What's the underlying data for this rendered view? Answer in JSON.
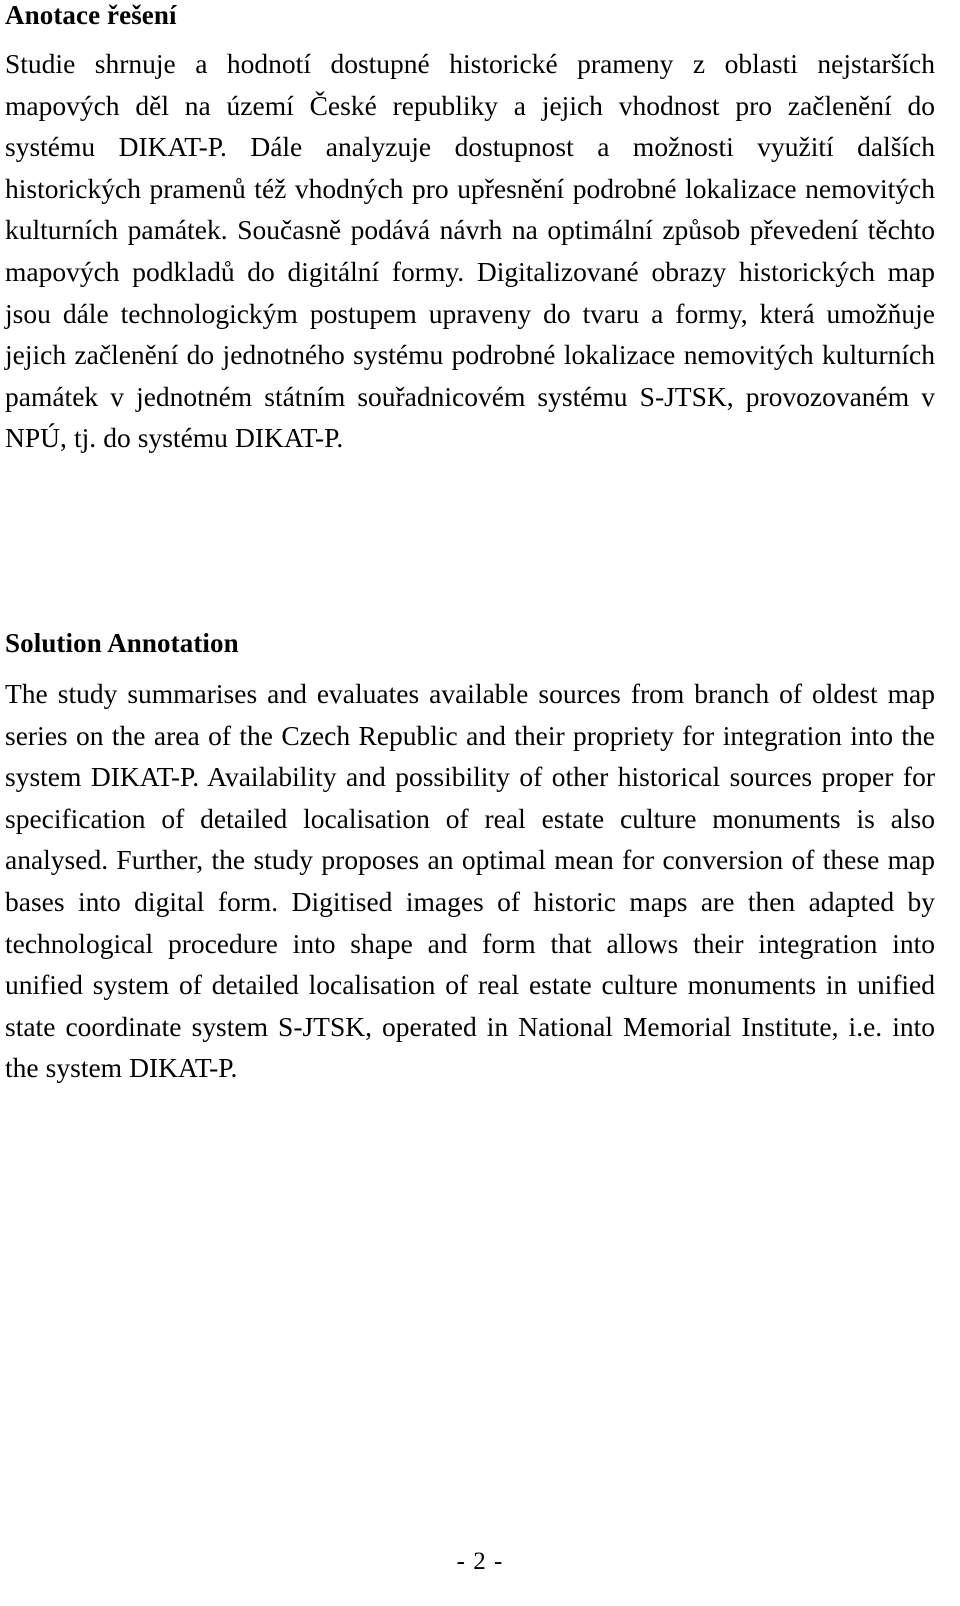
{
  "document": {
    "page_number_label": "- 2 -"
  },
  "sections": {
    "czech": {
      "heading": "Anotace řešení",
      "body": "Studie shrnuje a hodnotí dostupné historické prameny z oblasti nejstarších mapových děl na území České republiky a jejich vhodnost pro začlenění do systému DIKAT-P. Dále analyzuje dostupnost a možnosti využití dalších historických pramenů též vhodných pro upřesnění podrobné lokalizace nemovitých kulturních památek. Současně podává návrh na optimální způsob převedení těchto mapových podkladů do digitální formy. Digitalizované obrazy historických map jsou dále technologickým postupem upraveny do tvaru a formy, která umožňuje jejich začlenění do jednotného systému podrobné lokalizace nemovitých kulturních památek v jednotném státním souřadnicovém systému S-JTSK, provozovaném v NPÚ, tj. do systému DIKAT-P."
    },
    "english": {
      "heading": "Solution Annotation",
      "body": "The study summarises and evaluates available sources from branch of oldest map series on the area of the Czech Republic and their propriety for integration into the system DIKAT-P. Availability and possibility of other historical sources proper for specification of detailed localisation of real estate culture monuments is also analysed. Further, the study proposes an optimal mean for conversion of these map bases into digital form. Digitised images of historic maps are then adapted by technological procedure into shape and form that allows their integration into unified system of detailed localisation of real estate culture monuments in unified state coordinate system S-JTSK, operated in National Memorial Institute, i.e. into the system DIKAT-P."
    }
  }
}
